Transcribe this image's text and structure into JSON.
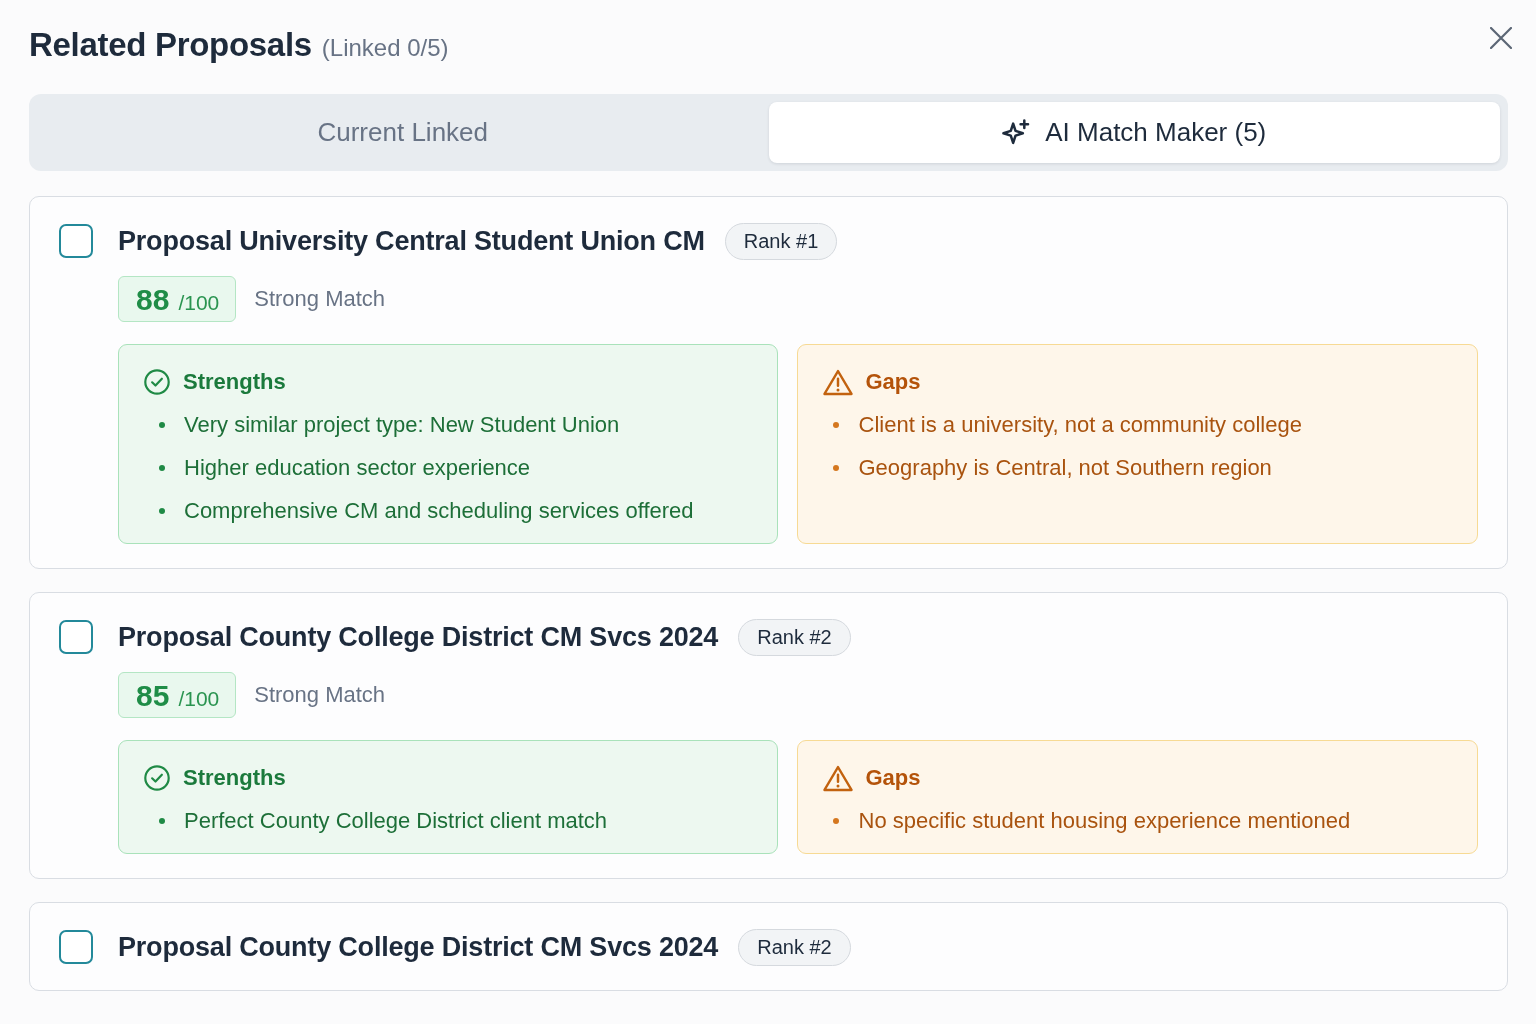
{
  "dialog": {
    "title": "Related Proposals",
    "linked_count": "(Linked 0/5)"
  },
  "tabs": [
    {
      "label": "Current Linked",
      "kind": "plain",
      "selected": false
    },
    {
      "label": "AI Match Maker (5)",
      "kind": "ai",
      "selected": true
    }
  ],
  "proposals": [
    {
      "title": "Proposal University Central Student Union CM",
      "rank": "Rank #1",
      "checked": false,
      "score": "88",
      "score_max": "/100",
      "match_label": "Strong Match",
      "analysis": [
        {
          "kind": "strengths",
          "heading": "Strengths",
          "items": [
            "Very similar project type: New Student Union",
            "Higher education sector experience",
            "Comprehensive CM and scheduling services offered"
          ]
        },
        {
          "kind": "gaps",
          "heading": "Gaps",
          "items": [
            "Client is a university, not a community college",
            "Geography is Central, not Southern region"
          ]
        }
      ]
    },
    {
      "title": "Proposal County College District CM Svcs 2024",
      "rank": "Rank #2",
      "checked": false,
      "score": "85",
      "score_max": "/100",
      "match_label": "Strong Match",
      "analysis": [
        {
          "kind": "strengths",
          "heading": "Strengths",
          "items": [
            "Perfect County College District client match"
          ]
        },
        {
          "kind": "gaps",
          "heading": "Gaps",
          "items": [
            "No specific student housing experience mentioned"
          ]
        }
      ]
    },
    {
      "title": "Proposal County College District CM Svcs 2024",
      "rank": "Rank #2",
      "checked": false
    }
  ]
}
